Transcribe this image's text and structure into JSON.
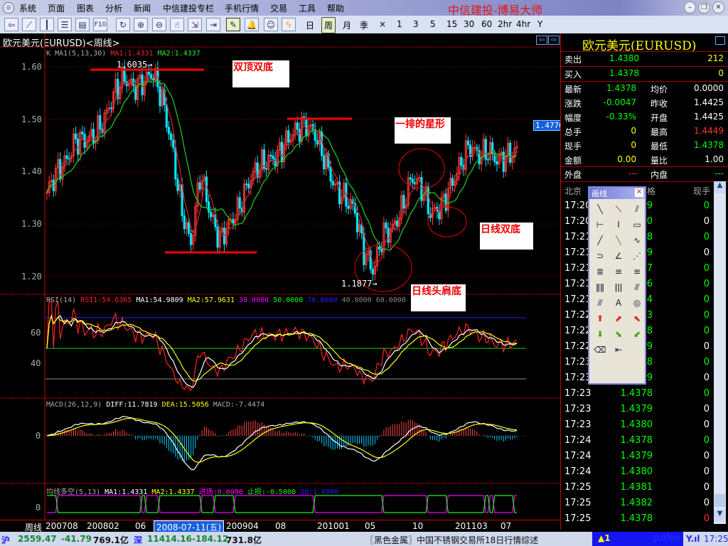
{
  "window": {
    "title": "中信建投-博易大师"
  },
  "menu": [
    "系统",
    "页面",
    "图表",
    "分析",
    "新闻",
    "中信建投专栏",
    "手机行情",
    "交易",
    "工具",
    "帮助"
  ],
  "toolbar": {
    "icons": [
      "back-icon",
      "line-chart-icon",
      "kline-icon",
      "table-icon",
      "window-icon",
      "f10-icon",
      "refresh-icon",
      "zoom-in-icon",
      "zoom-out-icon",
      "hand-icon",
      "switch-icon",
      "export-icon",
      "draw-line-icon",
      "alarm-icon",
      "users-icon",
      "lightning-icon"
    ],
    "f10_label": "F10",
    "periods": [
      "日",
      "周",
      "月",
      "季",
      "×",
      "1",
      "3",
      "5",
      "15",
      "30",
      "60",
      "2hr",
      "4hr",
      "Y"
    ],
    "active_period": "周"
  },
  "chart": {
    "title": "欧元美元(EURUSD)<周线>",
    "main_info": {
      "name": "K",
      "ma_label": "MA1(5,13,30)",
      "ma1": "MA1:1.4331",
      "ma2": "MA2:1.4337"
    },
    "y_ticks": [
      "1.60",
      "1.50",
      "1.40",
      "1.30",
      "1.20"
    ],
    "high_label": "1.6035→",
    "low_label": "1.1877→",
    "current_price_tag": "1.4770",
    "annotations": [
      "双顶双底",
      "一排的星形",
      "日线双底",
      "日线头肩底"
    ],
    "rsi_info": {
      "name": "RSI(14)",
      "rsi1": "RSI1:54.6365",
      "ma1": "MA1:54.9809",
      "ma2": "MA2:57.9631",
      "l30": "30.0000",
      "l50": "50.0000",
      "l70": "70.0000",
      "l40": "40.0000",
      "l60": "60.0000"
    },
    "rsi_ticks": [
      "60",
      "40"
    ],
    "macd_info": {
      "name": "MACD(26,12,9)",
      "diff": "DIFF:11.7819",
      "dea": "DEA:15.5056",
      "macd": "MACD:-7.4474"
    },
    "macd_ticks": [
      "0"
    ],
    "ls_info": {
      "name": "均线多空(5,13)",
      "ma1": "MA1:1.4331",
      "ma2": "MA2:1.4337",
      "entry": "进场:0.0000",
      "stop": "止损:-0.5000",
      "qq": "QQ:1.0000"
    },
    "ls_ticks": [
      "0"
    ],
    "x_axis_label": "周线",
    "x_ticks": [
      "200708",
      "200802",
      "06",
      "200904",
      "08",
      "201001",
      "05",
      "10",
      "201103",
      "07"
    ],
    "cursor_date": "2008-07-11(五)",
    "colors": {
      "up": "#ff3c3c",
      "down": "#00e5ff",
      "ma1": "#e02020",
      "ma2": "#20d020"
    }
  },
  "chart_data": {
    "type": "candlestick",
    "note_scale": "weekly",
    "monthly_close": [
      [
        "2007-08",
        1.36
      ],
      [
        "2007-09",
        1.4
      ],
      [
        "2007-10",
        1.42
      ],
      [
        "2007-11",
        1.46
      ],
      [
        "2007-12",
        1.46
      ],
      [
        "2008-01",
        1.47
      ],
      [
        "2008-02",
        1.5
      ],
      [
        "2008-03",
        1.55
      ],
      [
        "2008-04",
        1.58
      ],
      [
        "2008-05",
        1.56
      ],
      [
        "2008-06",
        1.57
      ],
      [
        "2008-07",
        1.59
      ],
      [
        "2008-08",
        1.54
      ],
      [
        "2008-09",
        1.45
      ],
      [
        "2008-10",
        1.33
      ],
      [
        "2008-11",
        1.26
      ],
      [
        "2008-12",
        1.4
      ],
      [
        "2009-01",
        1.32
      ],
      [
        "2009-02",
        1.27
      ],
      [
        "2009-03",
        1.3
      ],
      [
        "2009-04",
        1.33
      ],
      [
        "2009-05",
        1.38
      ],
      [
        "2009-06",
        1.41
      ],
      [
        "2009-07",
        1.42
      ],
      [
        "2009-08",
        1.43
      ],
      [
        "2009-09",
        1.46
      ],
      [
        "2009-10",
        1.48
      ],
      [
        "2009-11",
        1.49
      ],
      [
        "2009-12",
        1.47
      ],
      [
        "2010-01",
        1.42
      ],
      [
        "2010-02",
        1.37
      ],
      [
        "2010-03",
        1.35
      ],
      [
        "2010-04",
        1.33
      ],
      [
        "2010-05",
        1.25
      ],
      [
        "2010-06",
        1.21
      ],
      [
        "2010-07",
        1.28
      ],
      [
        "2010-08",
        1.29
      ],
      [
        "2010-09",
        1.33
      ],
      [
        "2010-10",
        1.39
      ],
      [
        "2010-11",
        1.37
      ],
      [
        "2010-12",
        1.32
      ],
      [
        "2011-01",
        1.33
      ],
      [
        "2011-02",
        1.37
      ],
      [
        "2011-03",
        1.41
      ],
      [
        "2011-04",
        1.45
      ],
      [
        "2011-05",
        1.43
      ],
      [
        "2011-06",
        1.44
      ],
      [
        "2011-07",
        1.42
      ],
      [
        "2011-08",
        1.43
      ],
      [
        "2011-09",
        1.44
      ]
    ],
    "high": 1.6035,
    "low": 1.1877,
    "ylim": [
      1.18,
      1.62
    ]
  },
  "quote": {
    "title": "欧元美元(EURUSD)",
    "sell": {
      "label": "卖出",
      "price": "1.4380",
      "vol": "212"
    },
    "buy": {
      "label": "买入",
      "price": "1.4378",
      "vol": "0"
    },
    "rows": [
      {
        "l1": "最新",
        "v1": "1.4378",
        "c1": "g",
        "l2": "均价",
        "v2": "0.0000",
        "c2": "w"
      },
      {
        "l1": "涨跌",
        "v1": "-0.0047",
        "c1": "g",
        "l2": "昨收",
        "v2": "1.4425",
        "c2": "w"
      },
      {
        "l1": "幅度",
        "v1": "-0.33%",
        "c1": "g",
        "l2": "开盘",
        "v2": "1.4425",
        "c2": "w"
      },
      {
        "l1": "总手",
        "v1": "0",
        "c1": "y",
        "l2": "最高",
        "v2": "1.4449",
        "c2": "r"
      },
      {
        "l1": "现手",
        "v1": "0",
        "c1": "y",
        "l2": "最低",
        "v2": "1.4378",
        "c2": "g"
      },
      {
        "l1": "金额",
        "v1": "0.00",
        "c1": "y",
        "l2": "量比",
        "v2": "1.00",
        "c2": "w"
      }
    ],
    "outer": {
      "label": "外盘",
      "value": "---"
    },
    "inner": {
      "label": "内盘",
      "value": "---"
    }
  },
  "ticks": {
    "headers": [
      "北京",
      "价格",
      "现手"
    ],
    "header_visible_fragment": "格",
    "rows": [
      [
        "17:20",
        "9",
        "0",
        "g"
      ],
      [
        "17:20",
        "0",
        "0",
        "w"
      ],
      [
        "17:21",
        "8",
        "0",
        "g"
      ],
      [
        "17:21",
        "9",
        "0",
        "w"
      ],
      [
        "17:21",
        "7",
        "0",
        "g"
      ],
      [
        "17:21",
        "6",
        "0",
        "g"
      ],
      [
        "17:21",
        "4",
        "0",
        "g"
      ],
      [
        "17:22",
        "3",
        "0",
        "g"
      ],
      [
        "17:22",
        "8",
        "0",
        "g"
      ],
      [
        "17:22",
        "9",
        "0",
        "w"
      ],
      [
        "17:23",
        "8",
        "0",
        "g"
      ],
      [
        "17:23",
        "9",
        "0",
        "w"
      ],
      [
        "17:23",
        "1.4378",
        "0",
        "g"
      ],
      [
        "17:23",
        "1.4379",
        "0",
        "w"
      ],
      [
        "17:23",
        "1.4380",
        "0",
        "w"
      ],
      [
        "17:24",
        "1.4378",
        "0",
        "g"
      ],
      [
        "17:24",
        "1.4379",
        "0",
        "w"
      ],
      [
        "17:24",
        "1.4380",
        "0",
        "w"
      ],
      [
        "17:25",
        "1.4381",
        "0",
        "w"
      ],
      [
        "17:25",
        "1.4382",
        "0",
        "w"
      ],
      [
        "17:25",
        "1.4378",
        "0",
        "r"
      ]
    ]
  },
  "drawing_toolbox": {
    "title": "画线",
    "tools": [
      "line-icon",
      "segment-icon",
      "parallel-lines-icon",
      "horizontal-line-icon",
      "vertical-line-icon",
      "rectangle-icon",
      "ray-icon",
      "ray-down-icon",
      "sine-icon",
      "arc-icon",
      "angle-icon",
      "fan-icon",
      "gann-grid-icon",
      "percent-lines-icon",
      "percent-lines-2-icon",
      "cycle-lines-icon",
      "fibonacci-time-icon",
      "channel-icon",
      "speed-lines-icon",
      "text-icon",
      "gann-circle-icon",
      "up-arrow-icon",
      "up-right-arrow-icon",
      "up-left-arrow-icon",
      "down-arrow-icon",
      "down-right-arrow-icon",
      "down-left-arrow-icon",
      "eraser-icon",
      "delete-lines-icon"
    ],
    "text_tool_label": "A"
  },
  "statusbar": {
    "sh_label": "沪",
    "sh_index": "2559.47",
    "sh_change": "-41.79",
    "sh_amount": "769.1亿",
    "sz_label": "深",
    "sz_index": "11414.16",
    "sz_change": "-184.12",
    "sz_amount": "731.8亿",
    "news": "〖黑色金属〗中国不锈钢交易所18日行情综述",
    "alert": "▲1",
    "brand": "pobo",
    "time": "17:25"
  }
}
